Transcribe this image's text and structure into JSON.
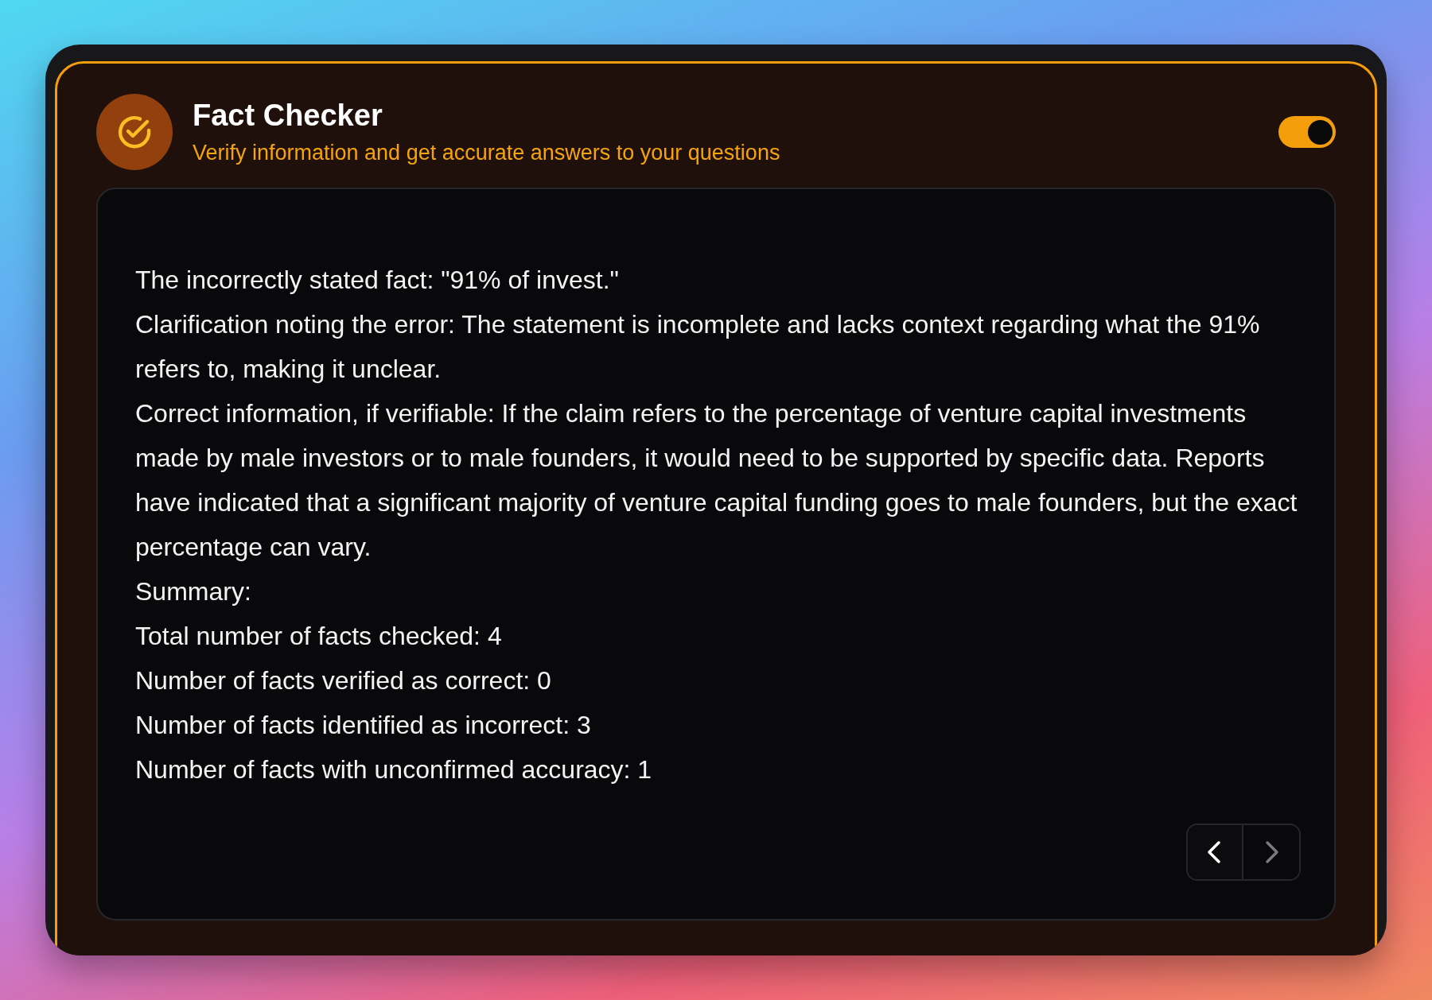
{
  "header": {
    "title": "Fact Checker",
    "subtitle": "Verify information and get accurate answers to your questions",
    "toggle": {
      "on": true
    }
  },
  "response": {
    "lines": [
      "The incorrectly stated fact: \"91% of invest.\"",
      "Clarification noting the error: The statement is incomplete and lacks context regarding what the 91% refers to, making it unclear.",
      "Correct information, if verifiable: If the claim refers to the percentage of venture capital investments made by male investors or to male founders, it would need to be supported by specific data. Reports have indicated that a significant majority of venture capital funding goes to male founders, but the exact percentage can vary.",
      "Summary:",
      "Total number of facts checked: 4",
      "Number of facts verified as correct: 0",
      "Number of facts identified as incorrect: 3",
      "Number of facts with unconfirmed accuracy: 1"
    ]
  },
  "pager": {
    "previous": {
      "disabled": false
    },
    "next": {
      "disabled": true
    }
  }
}
